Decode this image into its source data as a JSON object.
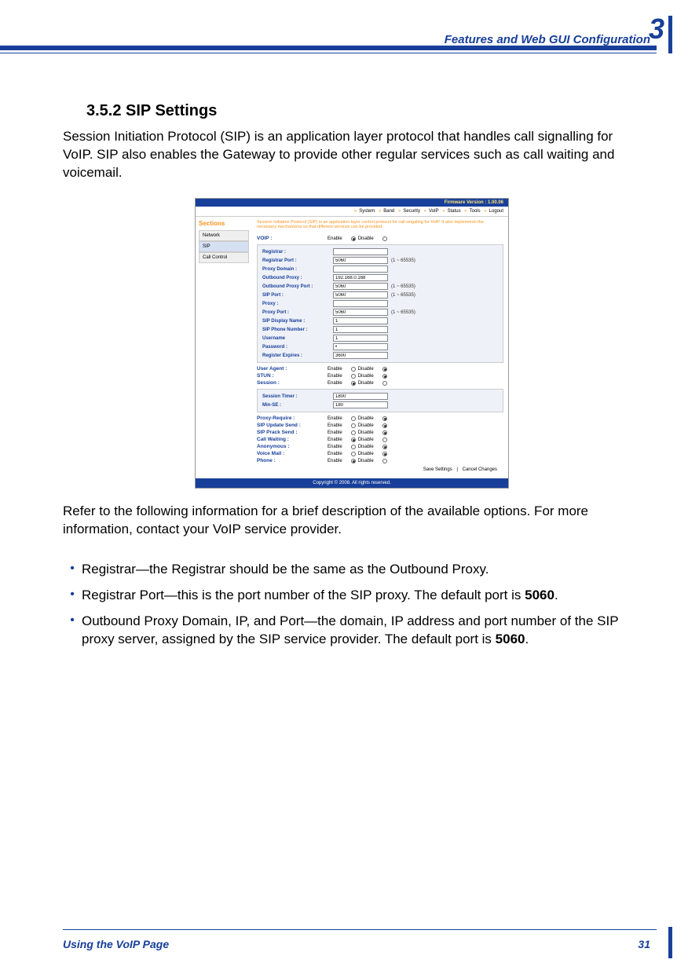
{
  "header": {
    "title": "Features and Web GUI Configuration",
    "chapter_number": "3"
  },
  "section": {
    "heading": "3.5.2 SIP Settings"
  },
  "paragraphs": {
    "intro": "Session Initiation Protocol (SIP) is an application layer protocol that handles call signalling for VoIP. SIP also enables the Gateway to provide other regular services such as call waiting and voicemail.",
    "after_screenshot": "Refer to the following information for a brief description of the available options. For more information, contact your VoIP service provider."
  },
  "bullets": [
    {
      "text": "Registrar—the Registrar should be the same as the Outbound Proxy."
    },
    {
      "text": "Registrar Port—this is the port number of the SIP proxy. The default port is ",
      "bold": "5060",
      "tail": "."
    },
    {
      "text": "Outbound Proxy Domain, IP, and Port—the domain, IP address and port number of the SIP proxy server, assigned by the SIP service provider. The default port is ",
      "bold": "5060",
      "tail": "."
    }
  ],
  "footer": {
    "text": "Using the VoIP Page",
    "page_number": "31"
  },
  "screenshot": {
    "firmware_label": "Firmware Version : 1.00.06",
    "nav": [
      "System",
      "Band",
      "Security",
      "VoIP",
      "Status",
      "Tools",
      "Logout"
    ],
    "sidebar": {
      "title": "Sections",
      "items": [
        "Network",
        "SIP",
        "Call Control"
      ],
      "selected_index": 1
    },
    "intro_text": "Session Initiation Protocol (SIP) is an application layer control protocol for call singaling for VoIP. It also implements the necessary mechanisms so that different services can be provided.",
    "voip_label": "VOIP :",
    "enable": "Enable",
    "disable": "Disable",
    "range_hint": "(1 ~ 65535)",
    "fields_registrar": [
      {
        "label": "Registrar :",
        "value": ""
      },
      {
        "label": "Registrar Port :",
        "value": "5060",
        "hint": true
      },
      {
        "label": "Proxy Domain :",
        "value": ""
      },
      {
        "label": "Outbound Proxy :",
        "value": "192.168.0.168"
      },
      {
        "label": "Outbound Proxy Port :",
        "value": "5060",
        "hint": true
      },
      {
        "label": "SIP Port :",
        "value": "5060",
        "hint": true
      },
      {
        "label": "Proxy :",
        "value": ""
      },
      {
        "label": "Proxy Port :",
        "value": "5060",
        "hint": true
      },
      {
        "label": "SIP Display Name :",
        "value": "1"
      },
      {
        "label": "SIP Phone Number :",
        "value": "1"
      },
      {
        "label": "Username",
        "value": "1"
      },
      {
        "label": "Password :",
        "value": "•"
      },
      {
        "label": "Register Expires :",
        "value": "3600"
      }
    ],
    "toggles_mid": [
      {
        "label": "User Agent :",
        "checked": "disable"
      },
      {
        "label": "STUN :",
        "checked": "disable"
      },
      {
        "label": "Session :",
        "checked": "enable"
      }
    ],
    "session_fields": [
      {
        "label": "Session Timer :",
        "value": "1800"
      },
      {
        "label": "Min-SE :",
        "value": "180"
      }
    ],
    "toggles_bottom": [
      {
        "label": "Proxy-Require :",
        "checked": "disable"
      },
      {
        "label": "SIP Update Send :",
        "checked": "disable"
      },
      {
        "label": "SIP Prack Send :",
        "checked": "disable"
      },
      {
        "label": "Call Waiting :",
        "checked": "enable"
      },
      {
        "label": "Anonymous :",
        "checked": "disable"
      },
      {
        "label": "Voice Mail :",
        "checked": "disable"
      },
      {
        "label": "Phone :",
        "checked": "enable"
      }
    ],
    "actions": {
      "save": "Save Settings",
      "sep": "|",
      "cancel": "Cancel Changes"
    },
    "copyright": "Copyright © 2008.  All rights reserved."
  }
}
